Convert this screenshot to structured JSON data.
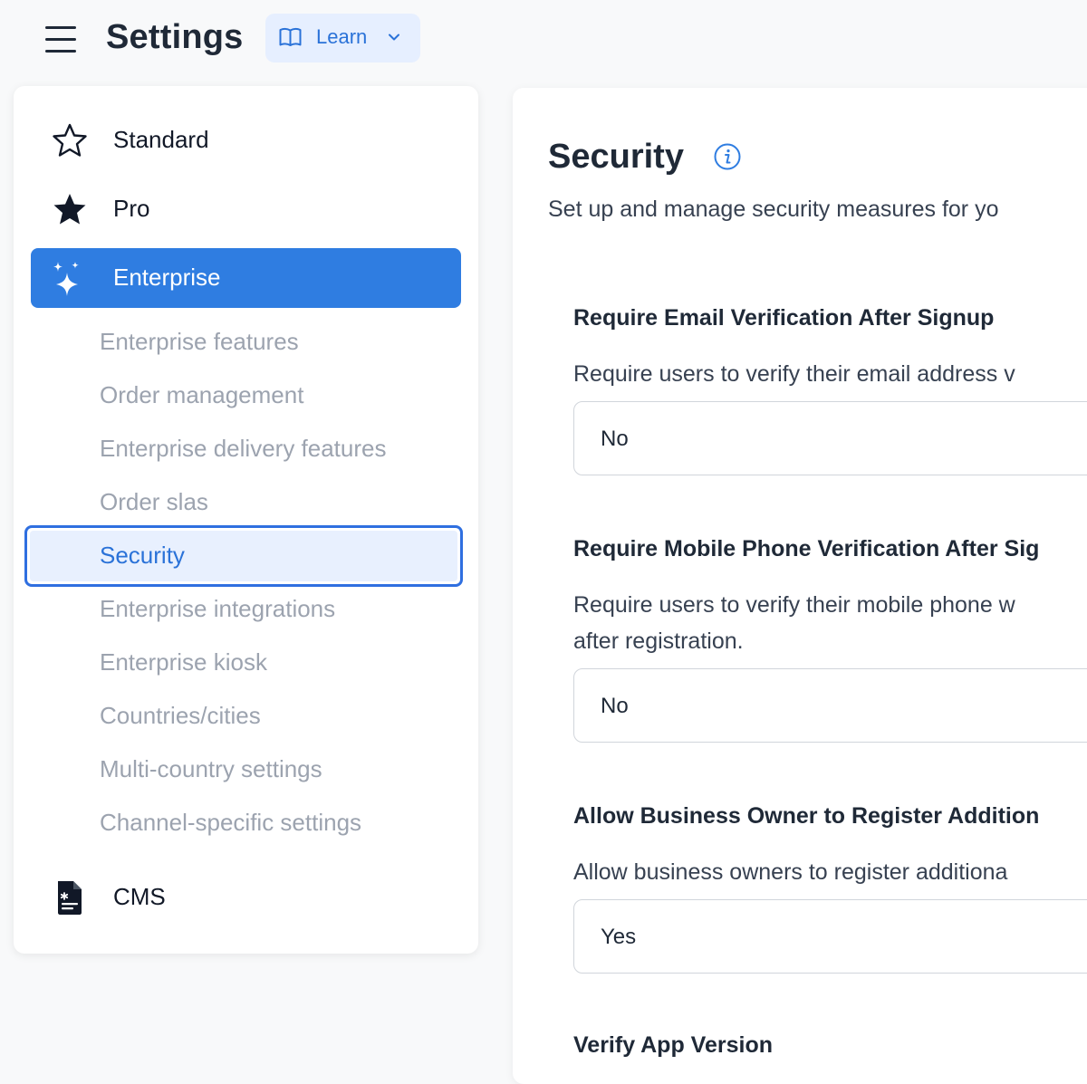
{
  "header": {
    "title": "Settings",
    "learn_label": "Learn"
  },
  "sidebar": {
    "top_items": [
      {
        "label": "Standard",
        "icon": "star-outline-icon"
      },
      {
        "label": "Pro",
        "icon": "star-filled-icon"
      },
      {
        "label": "Enterprise",
        "icon": "sparkles-icon"
      },
      {
        "label": "CMS",
        "icon": "document-icon"
      }
    ],
    "sub_items": [
      "Enterprise features",
      "Order management",
      "Enterprise delivery features",
      "Order slas",
      "Security",
      "Enterprise integrations",
      "Enterprise kiosk",
      "Countries/cities",
      "Multi-country settings",
      "Channel-specific settings"
    ]
  },
  "main": {
    "title": "Security",
    "subtitle": "Set up and manage security measures for yo",
    "fields": [
      {
        "label": "Require Email Verification After Signup",
        "desc": [
          "Require users to verify their email address v"
        ],
        "value": "No"
      },
      {
        "label": "Require Mobile Phone Verification After Sig",
        "desc": [
          "Require users to verify their mobile phone w",
          "after registration."
        ],
        "value": "No"
      },
      {
        "label": "Allow Business Owner to Register Addition",
        "desc": [
          "Allow business owners to register additiona"
        ],
        "value": "Yes"
      },
      {
        "label": "Verify App Version"
      }
    ]
  },
  "colors": {
    "accent": "#2f7de1",
    "selected_border": "#2f6fe0",
    "selected_bg": "#e8f0fe",
    "learn_bg": "#e6efff",
    "muted_text": "#9ca3af"
  }
}
